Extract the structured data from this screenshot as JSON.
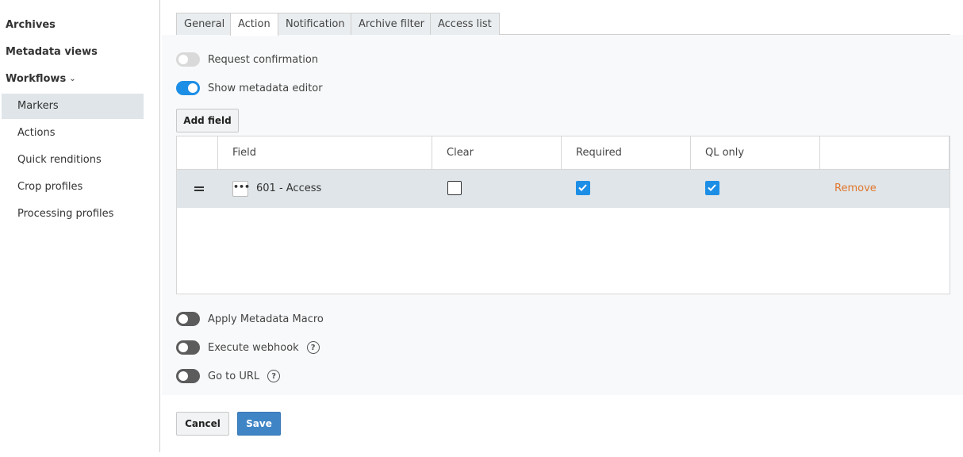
{
  "sidebar": {
    "items": [
      {
        "label": "Archives"
      },
      {
        "label": "Metadata views"
      },
      {
        "label": "Workflows"
      },
      {
        "label": "Markers"
      },
      {
        "label": "Actions"
      },
      {
        "label": "Quick renditions"
      },
      {
        "label": "Crop profiles"
      },
      {
        "label": "Processing profiles"
      }
    ]
  },
  "tabs": [
    {
      "label": "General"
    },
    {
      "label": "Action"
    },
    {
      "label": "Notification"
    },
    {
      "label": "Archive filter"
    },
    {
      "label": "Access list"
    }
  ],
  "toggles": {
    "request_confirmation": {
      "label": "Request confirmation",
      "on": false
    },
    "show_metadata_editor": {
      "label": "Show metadata editor",
      "on": true
    },
    "apply_metadata_macro": {
      "label": "Apply Metadata Macro",
      "on": false
    },
    "execute_webhook": {
      "label": "Execute webhook",
      "on": false
    },
    "go_to_url": {
      "label": "Go to URL",
      "on": false
    }
  },
  "add_field_label": "Add field",
  "table": {
    "headers": {
      "field": "Field",
      "clear": "Clear",
      "required": "Required",
      "ql_only": "QL only"
    },
    "rows": [
      {
        "more": "•••",
        "field": "601 - Access",
        "clear": false,
        "required": true,
        "ql_only": true,
        "remove": "Remove"
      }
    ]
  },
  "footer": {
    "cancel": "Cancel",
    "save": "Save"
  },
  "colors": {
    "accent": "#1d8ee6",
    "primary_button": "#3f85c6",
    "remove_link": "#e2762f"
  }
}
